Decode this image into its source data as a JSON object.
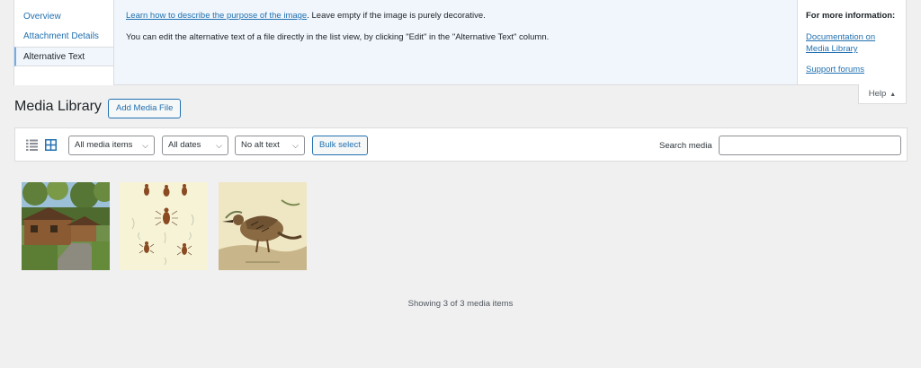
{
  "help": {
    "tabs": [
      {
        "label": "Overview"
      },
      {
        "label": "Attachment Details"
      },
      {
        "label": "Alternative Text"
      }
    ],
    "link_text": "Learn how to describe the purpose of the image",
    "line1_rest": ". Leave empty if the image is purely decorative.",
    "line2": "You can edit the alternative text of a file directly in the list view, by clicking \"Edit\" in the \"Alternative Text\" column.",
    "sidebar_title": "For more information:",
    "doc_link": "Documentation on Media Library",
    "support_link": "Support forums",
    "toggle_label": "Help",
    "toggle_icon": "triangle-up-icon"
  },
  "page": {
    "title": "Media Library",
    "add_button": "Add Media File"
  },
  "toolbar": {
    "type_filter": "All media items",
    "date_filter": "All dates",
    "alt_filter": "No alt text",
    "bulk_select": "Bulk select",
    "search_label": "Search media",
    "search_value": ""
  },
  "media": [
    {
      "subject": "wooden cabins in forest"
    },
    {
      "subject": "beetle illustration plate"
    },
    {
      "subject": "bird illustration"
    }
  ],
  "status": "Showing 3 of 3 media items",
  "colors": {
    "link": "#2271b1",
    "help_bg": "#f0f6fc",
    "page_bg": "#f0f0f1"
  }
}
